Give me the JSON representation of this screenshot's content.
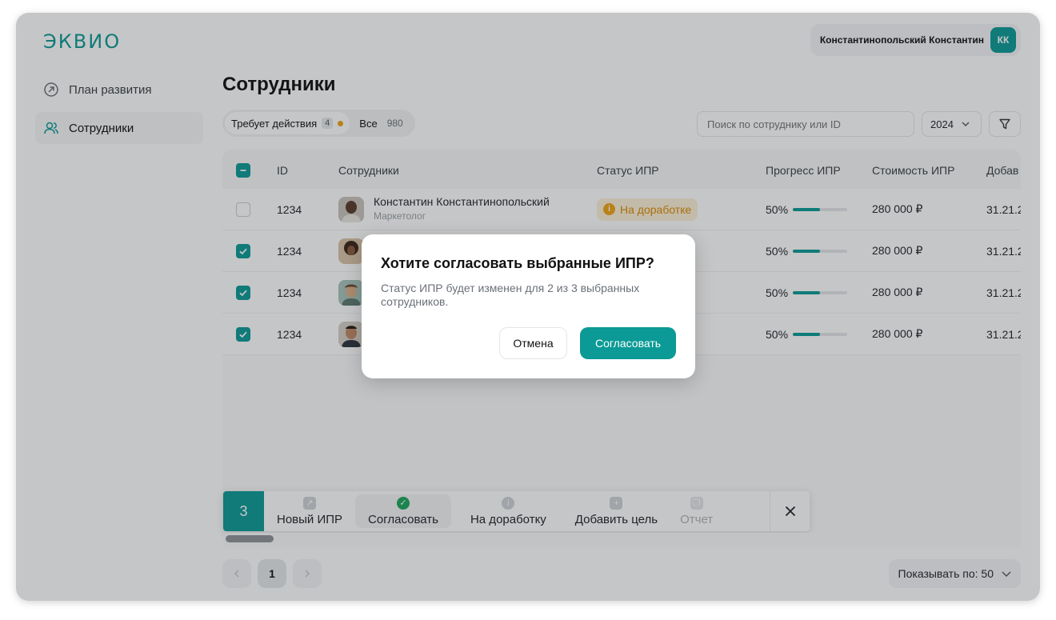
{
  "app": {
    "logo": "ЭКВИО"
  },
  "user": {
    "name": "Константинопольский Константин",
    "initials": "КК"
  },
  "sidebar": {
    "items": [
      {
        "label": "План развития"
      },
      {
        "label": "Сотрудники"
      }
    ]
  },
  "page": {
    "title": "Сотрудники"
  },
  "filters": {
    "tab_action": "Требует действия",
    "tab_action_count": "4",
    "tab_all": "Все",
    "tab_all_count": "980",
    "search_placeholder": "Поиск по сотруднику или ID",
    "year": "2024"
  },
  "table": {
    "columns": [
      "ID",
      "Сотрудники",
      "Статус ИПР",
      "Прогресс ИПР",
      "Стоимость ИПР",
      "Добав"
    ],
    "rows": [
      {
        "id": "1234",
        "name": "Константин Константинопольский",
        "role": "Маркетолог",
        "status": "На доработке",
        "progress_label": "50%",
        "progress": 0.5,
        "cost": "280 000 ₽",
        "date": "31.21.2"
      },
      {
        "id": "1234",
        "progress_label": "50%",
        "progress": 0.5,
        "cost": "280 000 ₽",
        "date": "31.21.2"
      },
      {
        "id": "1234",
        "progress_label": "50%",
        "progress": 0.5,
        "cost": "280 000 ₽",
        "date": "31.21.2"
      },
      {
        "id": "1234",
        "progress_label": "50%",
        "progress": 0.5,
        "cost": "280 000 ₽",
        "date": "31.21.2"
      }
    ]
  },
  "action_bar": {
    "selected_count": "3",
    "new_ipr": "Новый ИПР",
    "approve": "Согласовать",
    "rework": "На доработку",
    "add_goal": "Добавить цель",
    "report": "Отчет"
  },
  "pagination": {
    "page": "1",
    "per_page": "Показывать по: 50"
  },
  "modal": {
    "title": "Хотите согласовать выбранные ИПР?",
    "text": "Статус ИПР будет изменен для 2 из 3 выбранных сотрудников.",
    "cancel": "Отмена",
    "confirm": "Согласовать"
  },
  "colors": {
    "accent": "#0b9a96",
    "warning": "#f0a316",
    "success": "#1aa65e"
  }
}
